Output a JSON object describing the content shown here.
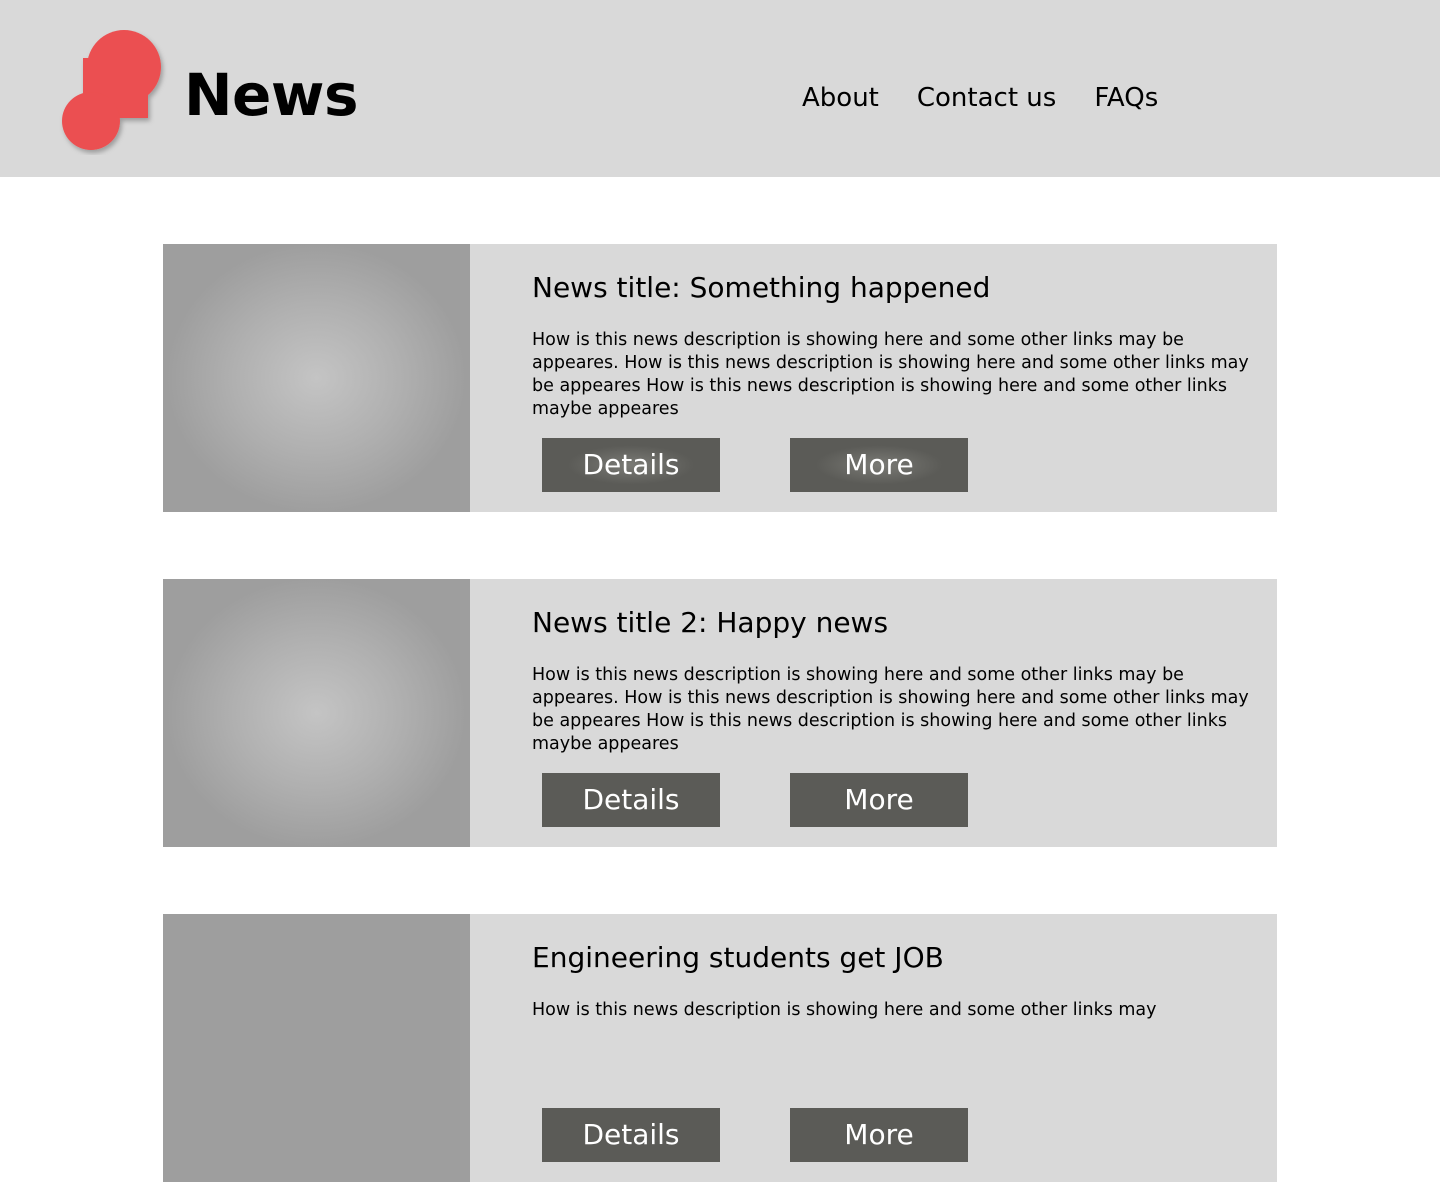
{
  "header": {
    "title": "News",
    "logo_color": "#eb5051",
    "nav": [
      {
        "label": "About"
      },
      {
        "label": "Contact us"
      },
      {
        "label": "FAQs"
      }
    ]
  },
  "articles": [
    {
      "title": "News title: Something happened",
      "description": "How is this news description is showing here and some other links may be appeares. How is this news description is showing here and some other links may be appeares How is this news description is showing here and some other links maybe appeares",
      "details_label": "Details",
      "more_label": "More"
    },
    {
      "title": "News title 2: Happy news",
      "description": "How is this news description is showing here and some other links may be appeares. How is this news description is showing here and some other links may be appeares How is this news description is showing here and some other links maybe appeares",
      "details_label": "Details",
      "more_label": "More"
    },
    {
      "title": "Engineering students get JOB",
      "description": "How is this news description is showing here and some other links may",
      "details_label": "Details",
      "more_label": "More"
    }
  ],
  "colors": {
    "header_bg": "#d9d9d9",
    "card_bg": "#d9d9d9",
    "image_placeholder": "#9e9e9e",
    "button_bg": "#5b5b57",
    "button_text": "#ffffff"
  }
}
